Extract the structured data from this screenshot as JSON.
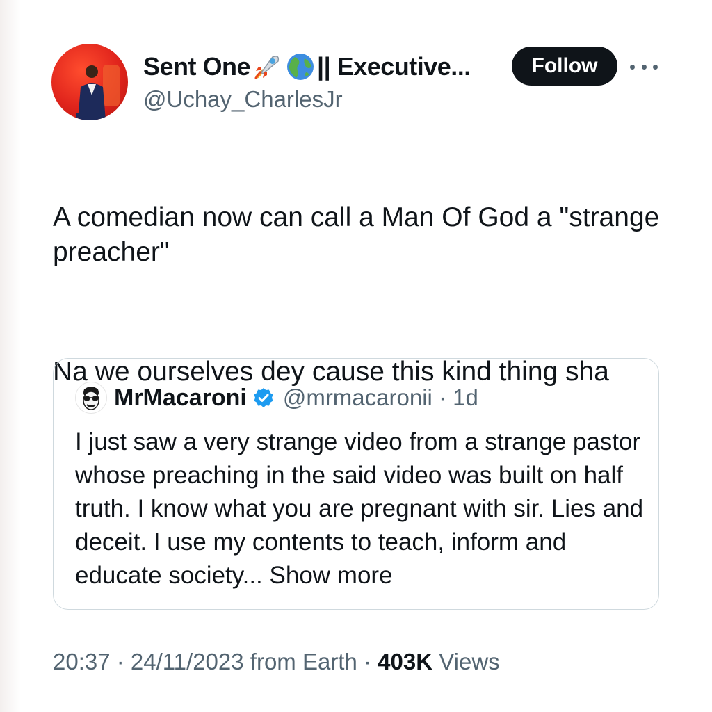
{
  "author": {
    "display_name_prefix": "Sent One",
    "display_name_suffix": "|| Executive...",
    "handle": "@Uchay_CharlesJr",
    "name_icons": [
      "rocket-icon",
      "globe-icon"
    ]
  },
  "follow_label": "Follow",
  "tweet": {
    "line1": "A comedian now can call a Man Of God a \"strange preacher\"",
    "line2": "Na we ourselves dey cause this kind thing sha"
  },
  "quote": {
    "name": "MrMacaroni",
    "handle_time": "@mrmacaronii · 1d",
    "body": "I just saw a very strange video from a strange pastor whose preaching in the said video was built on half truth. I know what you are pregnant with sir. Lies and deceit. I use my contents to teach, inform and educate society...",
    "show_more": "Show more"
  },
  "meta": {
    "timestamp": "20:37 · 24/11/2023 from Earth · ",
    "views_count": "403K",
    "views_label": "Views"
  },
  "colors": {
    "text": "#0f1419",
    "secondary": "#536471",
    "follow_bg": "#0f1419",
    "verified": "#1d9bf0",
    "border": "#cfd9de",
    "avatar_bg": "#e0241c"
  }
}
